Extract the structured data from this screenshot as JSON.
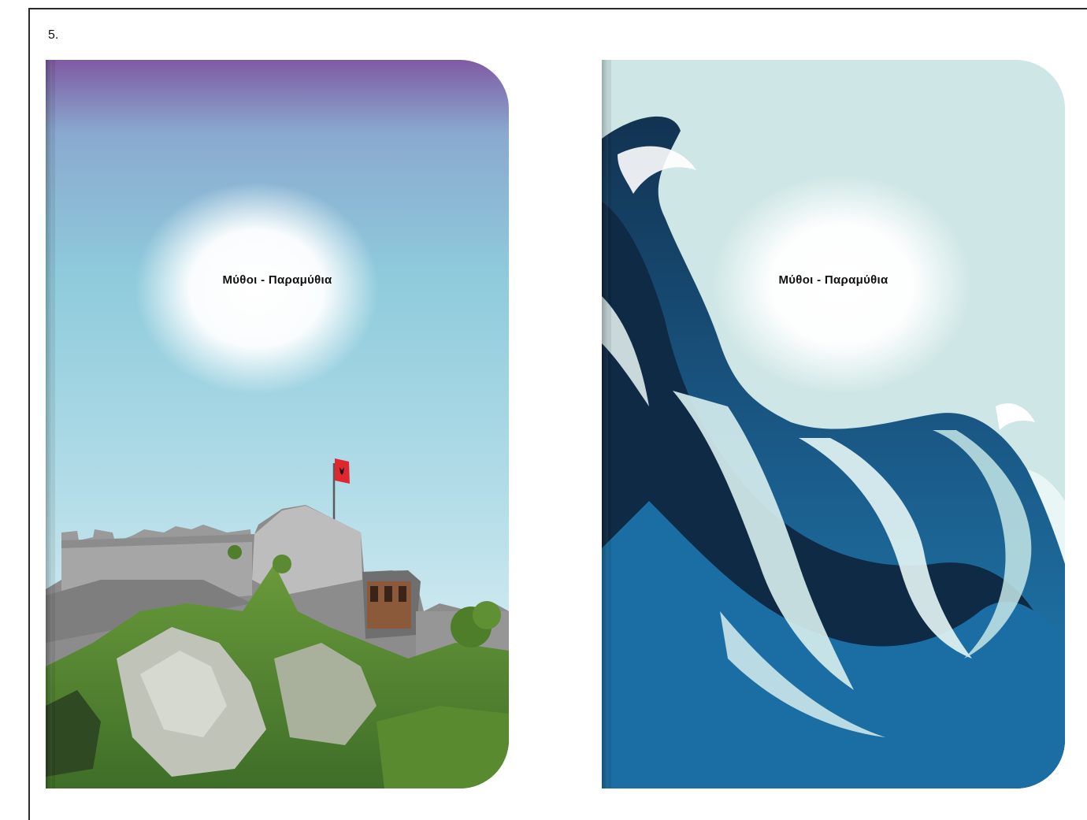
{
  "page": {
    "item_number": "5."
  },
  "covers": [
    {
      "title": "Μύθοι - Παραμύθια",
      "illustration": "castle-on-hill-with-flag",
      "colors": {
        "sky_top": "#7f5aa3",
        "sky_mid": "#8fc8dc",
        "flag": "#e0262f"
      }
    },
    {
      "title": "Μύθοι - Παραμύθια",
      "illustration": "ocean-wave",
      "colors": {
        "background": "#cfe6e6",
        "wave_dark": "#0d2a45",
        "wave_mid": "#1e6c9e",
        "foam": "#e8f6f5"
      }
    }
  ]
}
